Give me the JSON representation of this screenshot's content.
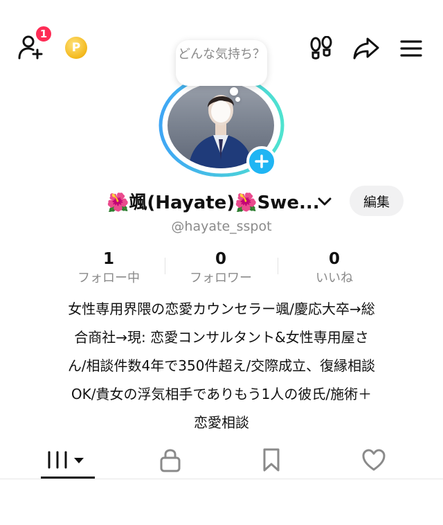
{
  "header": {
    "notification_count": "1",
    "coin_symbol": "P"
  },
  "mood_bubble": {
    "text": "どんな気持ち？"
  },
  "profile": {
    "display_name": "🌺颯(Hayate)🌺Swe...",
    "username": "@hayate_sspot",
    "edit_label": "編集"
  },
  "stats": [
    {
      "value": "1",
      "label": "フォロー中"
    },
    {
      "value": "0",
      "label": "フォロワー"
    },
    {
      "value": "0",
      "label": "いいね"
    }
  ],
  "bio": {
    "lines": [
      "女性専用界隈の恋愛カウンセラー颯/慶応大卒→総",
      "合商社→現: 恋愛コンサルタント&女性専用屋さ",
      "ん/相談件数4年で350件超え/交際成立、復縁相談",
      "OK/貴女の浮気相手でありもう1人の彼氏/施術＋",
      "恋愛相談"
    ]
  },
  "colors": {
    "accent_red": "#fe2c55",
    "accent_blue": "#20b5f3",
    "ring_start": "#3fa6f5",
    "ring_end": "#4fe3cf",
    "coin": "#f3b81c"
  },
  "tabs": [
    {
      "icon": "grid-dropdown-icon",
      "active": true
    },
    {
      "icon": "lock-icon",
      "active": false
    },
    {
      "icon": "bookmark-icon",
      "active": false
    },
    {
      "icon": "heart-icon",
      "active": false
    }
  ]
}
